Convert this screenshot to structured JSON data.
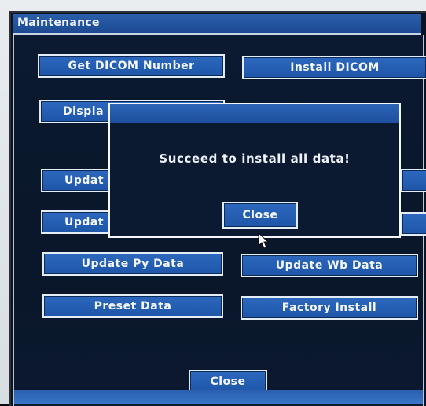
{
  "window": {
    "title": "Maintenance"
  },
  "buttons": {
    "get_dicom_number": "Get DICOM Number",
    "install_dicom": "Install DICOM",
    "display": "Displa",
    "update_1": "Updat",
    "update_2": "Updat",
    "update_py_data": "Update Py Data",
    "update_wb_data": "Update Wb Data",
    "preset_data": "Preset Data",
    "factory_install": "Factory Install",
    "close": "Close"
  },
  "dialog": {
    "message": "Succeed to install all data!",
    "close_label": "Close"
  },
  "colors": {
    "button_fill": "#1e56a8",
    "panel_bg": "#0a1629",
    "title_bar": "#2b5fab",
    "text": "#f3f6fb"
  }
}
